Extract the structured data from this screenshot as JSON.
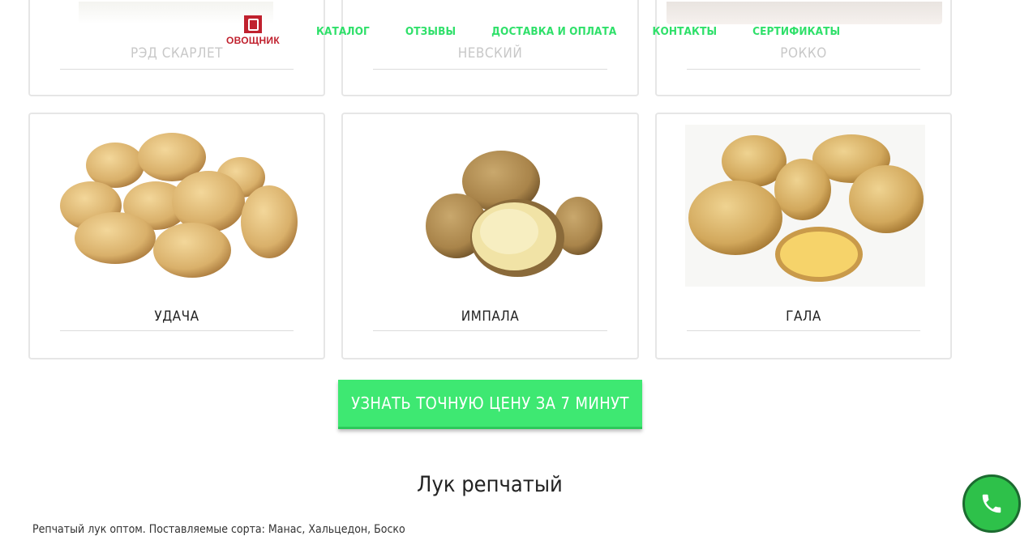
{
  "header": {
    "logo_text": "ОВОЩНИК",
    "nav": [
      "КАТАЛОГ",
      "ОТЗЫВЫ",
      "ДОСТАВКА И ОПЛАТА",
      "КОНТАКТЫ",
      "СЕРТИФИКАТЫ"
    ]
  },
  "top_cards": [
    {
      "title": "РЭД СКАРЛЕТ"
    },
    {
      "title": "НЕВСКИЙ"
    },
    {
      "title": "РОККО"
    }
  ],
  "cards": [
    {
      "title": "УДАЧА"
    },
    {
      "title": "ИМПАЛА"
    },
    {
      "title": "ГАЛА"
    }
  ],
  "cta_label": "УЗНАТЬ ТОЧНУЮ ЦЕНУ ЗА 7 МИНУТ",
  "section": {
    "title": "Лук репчатый",
    "description": "Репчатый лук оптом. Поставляемые сорта: Манас, Хальцедон, Боско"
  },
  "colors": {
    "accent": "#3ee872",
    "brand": "#c0212e",
    "phone": "#2ec14a"
  },
  "icons": {
    "phone": "phone-icon"
  }
}
